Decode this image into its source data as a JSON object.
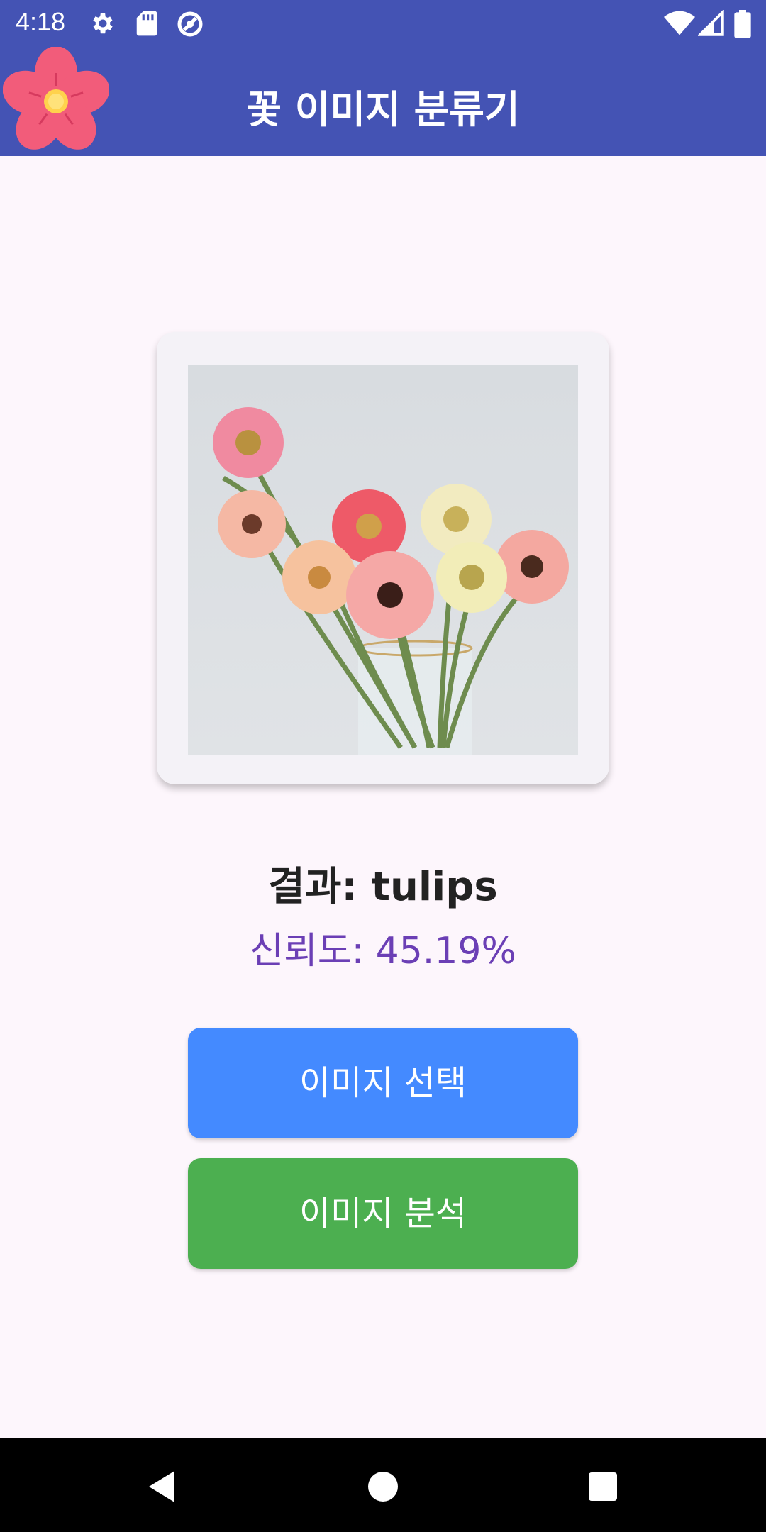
{
  "status_bar": {
    "time": "4:18",
    "left_icons": [
      "settings-icon",
      "sd-card-icon",
      "sync-icon"
    ],
    "right_icons": [
      "wifi-icon",
      "cell-signal-icon",
      "battery-icon"
    ]
  },
  "app_bar": {
    "title": "꽃 이미지 분류기",
    "logo": "flower-logo-icon",
    "color": "#4453B4"
  },
  "image_card": {
    "content": "gerbera-bouquet-in-glass-vase-photo"
  },
  "result": {
    "title": "결과: tulips",
    "confidence": "신뢰도: 45.19%"
  },
  "buttons": {
    "select_label": "이미지 선택",
    "analyze_label": "이미지 분석",
    "select_color": "#448AFF",
    "analyze_color": "#4CAF50"
  },
  "nav_bar": {
    "icons": [
      "back-icon",
      "home-icon",
      "recents-icon"
    ]
  }
}
